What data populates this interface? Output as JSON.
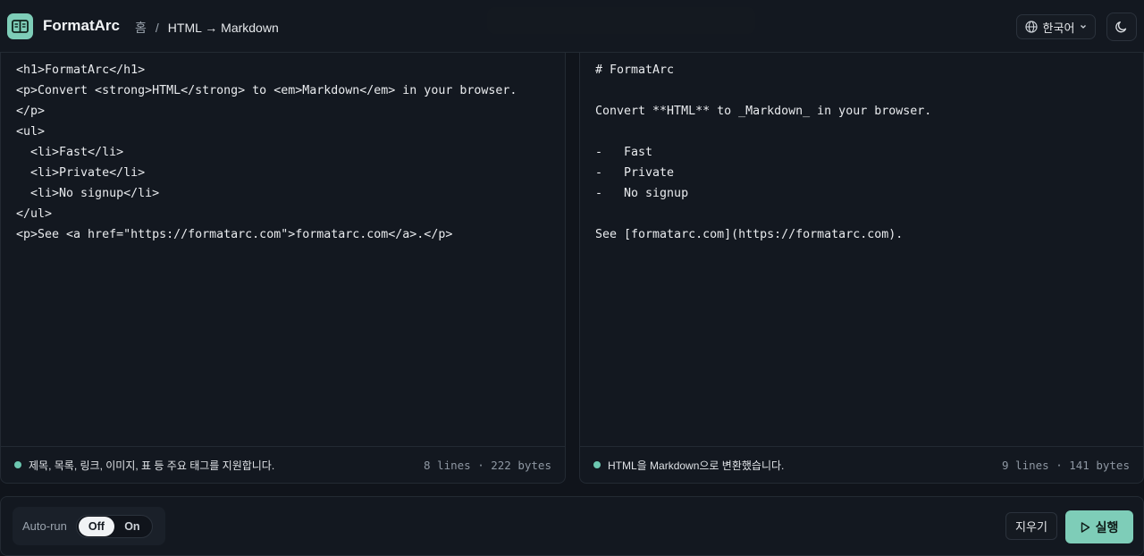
{
  "header": {
    "app_title": "FormatArc",
    "breadcrumb_home": "홈",
    "breadcrumb_sep": "/",
    "breadcrumb_current": "HTML → Markdown",
    "language": "한국어"
  },
  "input_panel": {
    "lines": [
      "<h1>FormatArc</h1>",
      "<p>Convert <strong>HTML</strong> to <em>Markdown</em> in your browser.",
      "</p>",
      "<ul>",
      "  <li>Fast</li>",
      "  <li>Private</li>",
      "  <li>No signup</li>",
      "</ul>",
      "<p>See <a href=\"https://formatarc.com\">formatarc.com</a>.</p>"
    ],
    "footer_message": "제목, 목록, 링크, 이미지, 표 등 주요 태그를 지원합니다.",
    "footer_stats": "8 lines · 222 bytes"
  },
  "output_panel": {
    "lines": [
      "# FormatArc",
      "",
      "Convert **HTML** to _Markdown_ in your browser.",
      "",
      "-   Fast",
      "-   Private",
      "-   No signup",
      "",
      "See [formatarc.com](https://formatarc.com)."
    ],
    "footer_message": "HTML을 Markdown으로 변환했습니다.",
    "footer_stats": "9 lines · 141 bytes"
  },
  "bottom_bar": {
    "autorun_label": "Auto-run",
    "toggle_off": "Off",
    "toggle_on": "On",
    "clear_label": "지우기",
    "run_label": "실행"
  },
  "colors": {
    "accent": "#7ecdb8",
    "background": "#10141b",
    "status_dot": "#6cc7b0"
  }
}
